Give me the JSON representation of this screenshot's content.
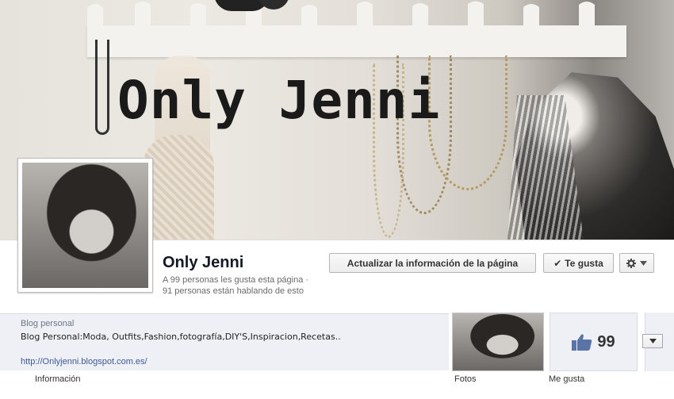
{
  "cover": {
    "title": "Only Jenni"
  },
  "page": {
    "name": "Only Jenni",
    "likes_line": "A 99 personas les gusta esta página ·",
    "talking_line": "91 personas están hablando de esto"
  },
  "actions": {
    "update_label": "Actualizar la información de la página",
    "like_label": "Te gusta",
    "gear_icon": "gear-icon",
    "dropdown_icon": "chevron-down-icon"
  },
  "about": {
    "category": "Blog personal",
    "description": "Blog Personal:Moda, Outfits,Fashion,fotografía,DIY'S,Inspiracion,Recetas..",
    "link": "http://Onlyjenni.blogspot.com.es/",
    "label": "Información"
  },
  "apps": {
    "photos_label": "Fotos",
    "likes_label": "Me gusta",
    "likes_count": "99",
    "thumbs_icon": "thumbs-up-icon",
    "accent": "#3b5998"
  }
}
